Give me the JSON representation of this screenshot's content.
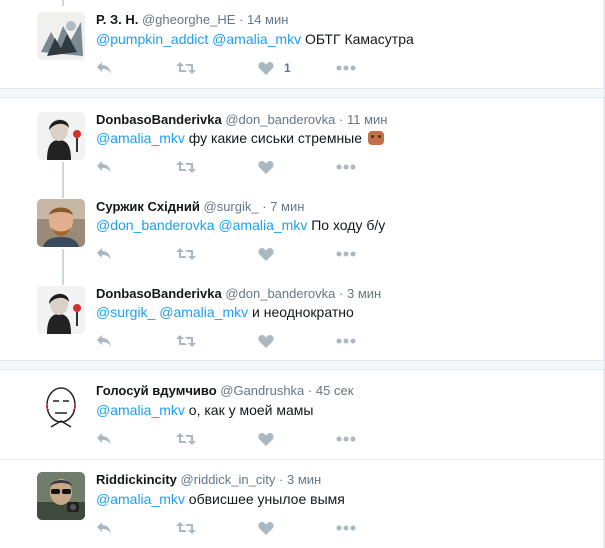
{
  "tweets": [
    {
      "name": "Р. З. Н.",
      "handle": "@gheorghe_HE",
      "dot": "·",
      "time": "14 мин",
      "mentions": [
        "@pumpkin_addict",
        "@amalia_mkv"
      ],
      "text": "ОБТГ Камасутра",
      "like_count": "1",
      "avatar_icon": "sketch-avatar-icon"
    },
    {
      "name": "DonbasoBanderivka",
      "handle": "@don_banderovka",
      "dot": "·",
      "time": "11 мин",
      "mentions": [
        "@amalia_mkv"
      ],
      "text": "фу какие сиськи стремные",
      "emoji": "monkey-emoji-icon",
      "avatar_icon": "woman-portrait-avatar-icon"
    },
    {
      "name": "Суржик Східний",
      "handle": "@surgik_",
      "dot": "·",
      "time": "7 мин",
      "mentions": [
        "@don_banderovka",
        "@amalia_mkv"
      ],
      "text": "По ходу б/у",
      "avatar_icon": "man-photo-avatar-icon"
    },
    {
      "name": "DonbasoBanderivka",
      "handle": "@don_banderovka",
      "dot": "·",
      "time": "3 мин",
      "mentions": [
        "@surgik_",
        "@amalia_mkv"
      ],
      "text": "и неоднократно",
      "avatar_icon": "woman-portrait-avatar-icon"
    },
    {
      "name": "Голосуй вдумчиво",
      "handle": "@Gandrushka",
      "dot": "·",
      "time": "45 сек",
      "mentions": [
        "@amalia_mkv"
      ],
      "text": "о, как у моей мамы",
      "avatar_icon": "cartoon-face-avatar-icon"
    },
    {
      "name": "Riddickincity",
      "handle": "@riddick_in_city",
      "dot": "·",
      "time": "3 мин",
      "mentions": [
        "@amalia_mkv"
      ],
      "text": "обвисшее унылое вымя",
      "avatar_icon": "man-sunglasses-avatar-icon"
    }
  ],
  "colors": {
    "mention": "#1da1f2",
    "icon": "#aab8c2",
    "secondary": "#657786"
  }
}
